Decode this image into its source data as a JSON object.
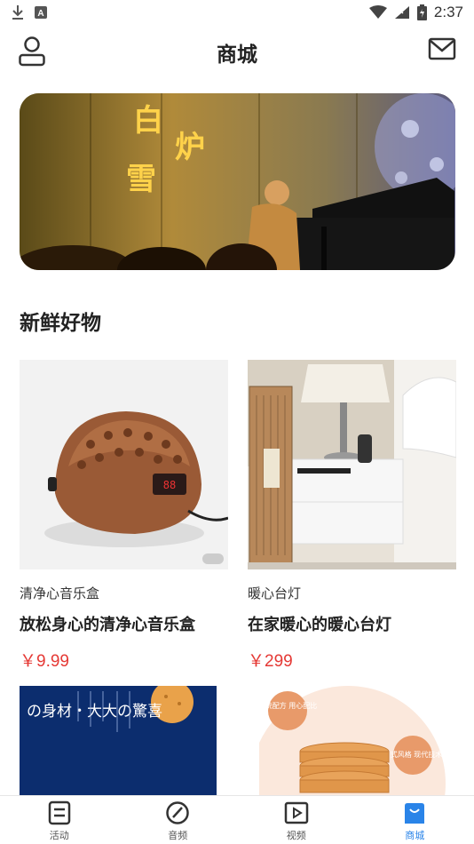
{
  "status_bar": {
    "time": "2:37"
  },
  "header": {
    "title": "商城"
  },
  "banner": {
    "text_chars": [
      "白",
      "炉",
      "雪"
    ]
  },
  "section": {
    "title": "新鲜好物"
  },
  "products": [
    {
      "category": "清净心音乐盒",
      "name": "放松身心的清净心音乐盒",
      "price": "￥9.99"
    },
    {
      "category": "暖心台灯",
      "name": "在家暖心的暖心台灯",
      "price": "￥299"
    }
  ],
  "preview_cards": [
    {
      "lines": [
        "の身材・大大の驚喜"
      ]
    },
    {
      "badges": [
        "传统配方 用心配比",
        "日式风格 现代技术"
      ]
    }
  ],
  "bottom_nav": {
    "items": [
      {
        "label": "活动",
        "icon": "list-icon"
      },
      {
        "label": "音频",
        "icon": "gauge-icon"
      },
      {
        "label": "视频",
        "icon": "play-icon"
      },
      {
        "label": "商城",
        "icon": "shopping-bag-icon"
      }
    ],
    "active_index": 3
  },
  "colors": {
    "accent": "#2a84e8",
    "price": "#e53935"
  }
}
